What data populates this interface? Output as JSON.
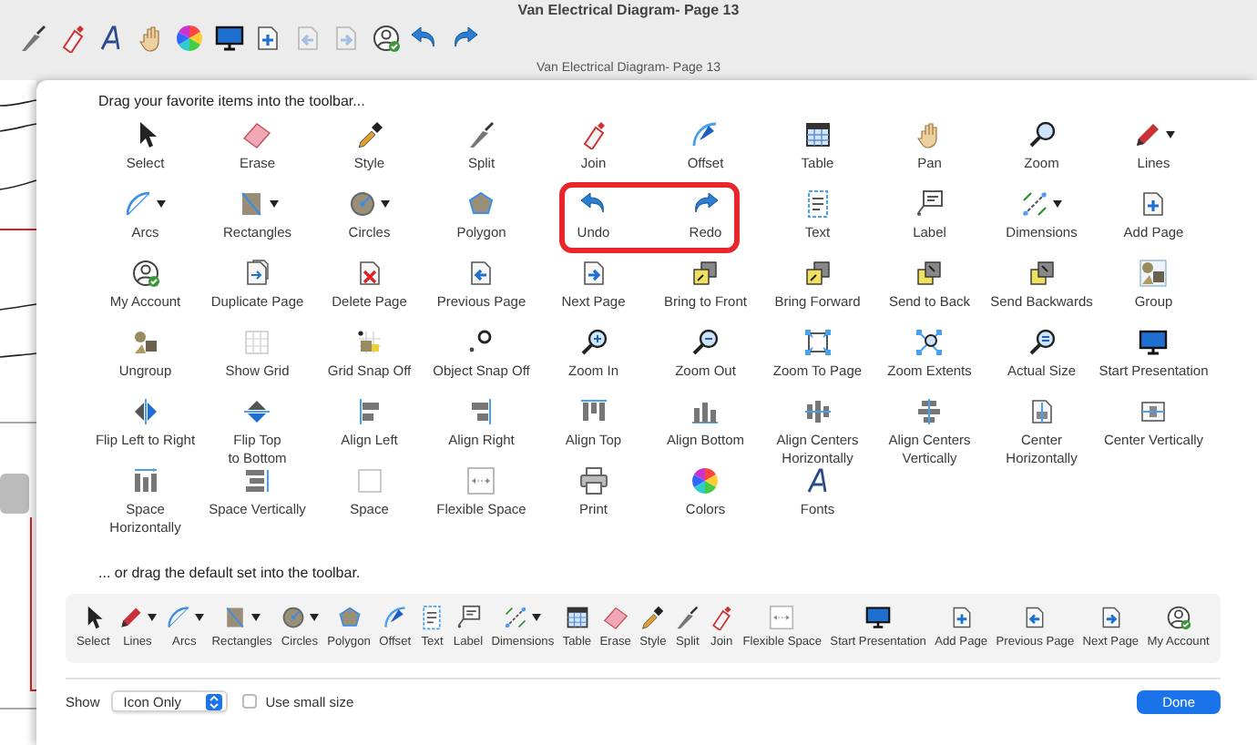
{
  "window": {
    "title": "Van Electrical Diagram- Page 13"
  },
  "toolbar": [
    {
      "disabled": false
    },
    {
      "disabled": false
    },
    {
      "disabled": false
    },
    {
      "disabled": false
    },
    {
      "disabled": false
    },
    {
      "disabled": false
    },
    {
      "disabled": false
    },
    {
      "disabled": true
    },
    {
      "disabled": true
    },
    {
      "disabled": false
    },
    {
      "disabled": false
    },
    {
      "disabled": false
    }
  ],
  "document_title": "Van Electrical Diagram- Page 13",
  "palette": {
    "heading": "Drag your favorite items into the toolbar...",
    "items": [
      {
        "label": "Select"
      },
      {
        "label": "Erase"
      },
      {
        "label": "Style"
      },
      {
        "label": "Split"
      },
      {
        "label": "Join"
      },
      {
        "label": "Offset"
      },
      {
        "label": "Table"
      },
      {
        "label": "Pan"
      },
      {
        "label": "Zoom"
      },
      {
        "label": "Lines",
        "dropdown": true
      },
      {
        "label": "Arcs",
        "dropdown": true
      },
      {
        "label": "Rectangles",
        "dropdown": true
      },
      {
        "label": "Circles",
        "dropdown": true
      },
      {
        "label": "Polygon"
      },
      {
        "label": "Undo",
        "highlighted": true
      },
      {
        "label": "Redo",
        "highlighted": true
      },
      {
        "label": "Text"
      },
      {
        "label": "Label"
      },
      {
        "label": "Dimensions",
        "dropdown": true
      },
      {
        "label": "Add Page"
      },
      {
        "label": "My Account"
      },
      {
        "label": "Duplicate Page"
      },
      {
        "label": "Delete Page"
      },
      {
        "label": "Previous Page"
      },
      {
        "label": "Next Page"
      },
      {
        "label": "Bring to Front"
      },
      {
        "label": "Bring Forward"
      },
      {
        "label": "Send to Back"
      },
      {
        "label": "Send Backwards"
      },
      {
        "label": "Group"
      },
      {
        "label": "Ungroup"
      },
      {
        "label": "Show Grid"
      },
      {
        "label": "Grid Snap Off"
      },
      {
        "label": "Object Snap Off"
      },
      {
        "label": "Zoom In"
      },
      {
        "label": "Zoom Out"
      },
      {
        "label": "Zoom To Page"
      },
      {
        "label": "Zoom Extents"
      },
      {
        "label": "Actual Size"
      },
      {
        "label": "Start Presentation"
      },
      {
        "label": "Flip Left to Right"
      },
      {
        "label": "Flip Top\nto Bottom"
      },
      {
        "label": "Align Left"
      },
      {
        "label": "Align Right"
      },
      {
        "label": "Align Top"
      },
      {
        "label": "Align Bottom"
      },
      {
        "label": "Align Centers\nHorizontally"
      },
      {
        "label": "Align Centers\nVertically"
      },
      {
        "label": "Center\nHorizontally"
      },
      {
        "label": "Center Vertically"
      },
      {
        "label": "Space\nHorizontally"
      },
      {
        "label": "Space Vertically"
      },
      {
        "label": "Space"
      },
      {
        "label": "Flexible Space"
      },
      {
        "label": "Print"
      },
      {
        "label": "Colors"
      },
      {
        "label": "Fonts"
      }
    ]
  },
  "default_set": {
    "heading": "... or drag the default set into the toolbar.",
    "items": [
      {
        "label": "Select"
      },
      {
        "label": "Lines",
        "dropdown": true
      },
      {
        "label": "Arcs",
        "dropdown": true
      },
      {
        "label": "Rectangles",
        "dropdown": true
      },
      {
        "label": "Circles",
        "dropdown": true
      },
      {
        "label": "Polygon"
      },
      {
        "label": "Offset"
      },
      {
        "label": "Text"
      },
      {
        "label": "Label"
      },
      {
        "label": "Dimensions",
        "dropdown": true
      },
      {
        "label": "Table"
      },
      {
        "label": "Erase"
      },
      {
        "label": "Style"
      },
      {
        "label": "Split"
      },
      {
        "label": "Join"
      },
      {
        "label": "Flexible Space"
      },
      {
        "label": "Start Presentation"
      },
      {
        "label": "Add Page"
      },
      {
        "label": "Previous Page"
      },
      {
        "label": "Next Page"
      },
      {
        "label": "My Account"
      }
    ]
  },
  "bottom": {
    "show_label": "Show",
    "show_select": {
      "value": "Icon Only"
    },
    "small_size": {
      "label": "Use small size",
      "checked": false
    },
    "done": "Done"
  }
}
